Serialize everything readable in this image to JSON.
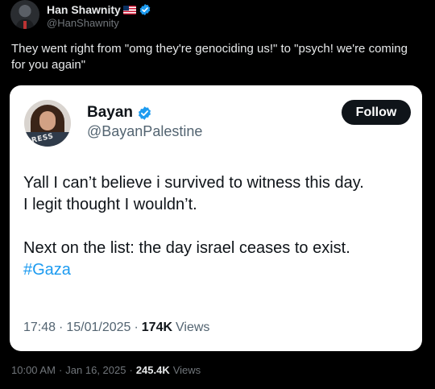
{
  "post": {
    "author_name": "Han Shawnity",
    "author_handle": "@HanShawnity",
    "flag_icon": "us-flag-icon",
    "verified_color": "#1d9bf0",
    "text": "They went right from \"omg they're genociding us!\" to \"psych! we're coming for you again\"",
    "time": "10:00 AM",
    "sep1": "·",
    "date": "Jan 16, 2025",
    "sep2": "·",
    "views_count": "245.4K",
    "views_label": "Views"
  },
  "quote": {
    "author_name": "Bayan",
    "author_handle": "@BayanPalestine",
    "avatar_text": "PRESS",
    "follow_label": "Follow",
    "line1": "Yall I can’t believe i survived to witness this day.",
    "line2": "I legit thought I wouldn’t.",
    "line3": "Next on the list: the day israel ceases to exist.",
    "hashtag": "#Gaza",
    "time": "17:48",
    "sep1": "·",
    "date": "15/01/2025",
    "sep2": "·",
    "views_count": "174K",
    "views_label": "Views",
    "hashtag_color": "#1d9bf0"
  }
}
